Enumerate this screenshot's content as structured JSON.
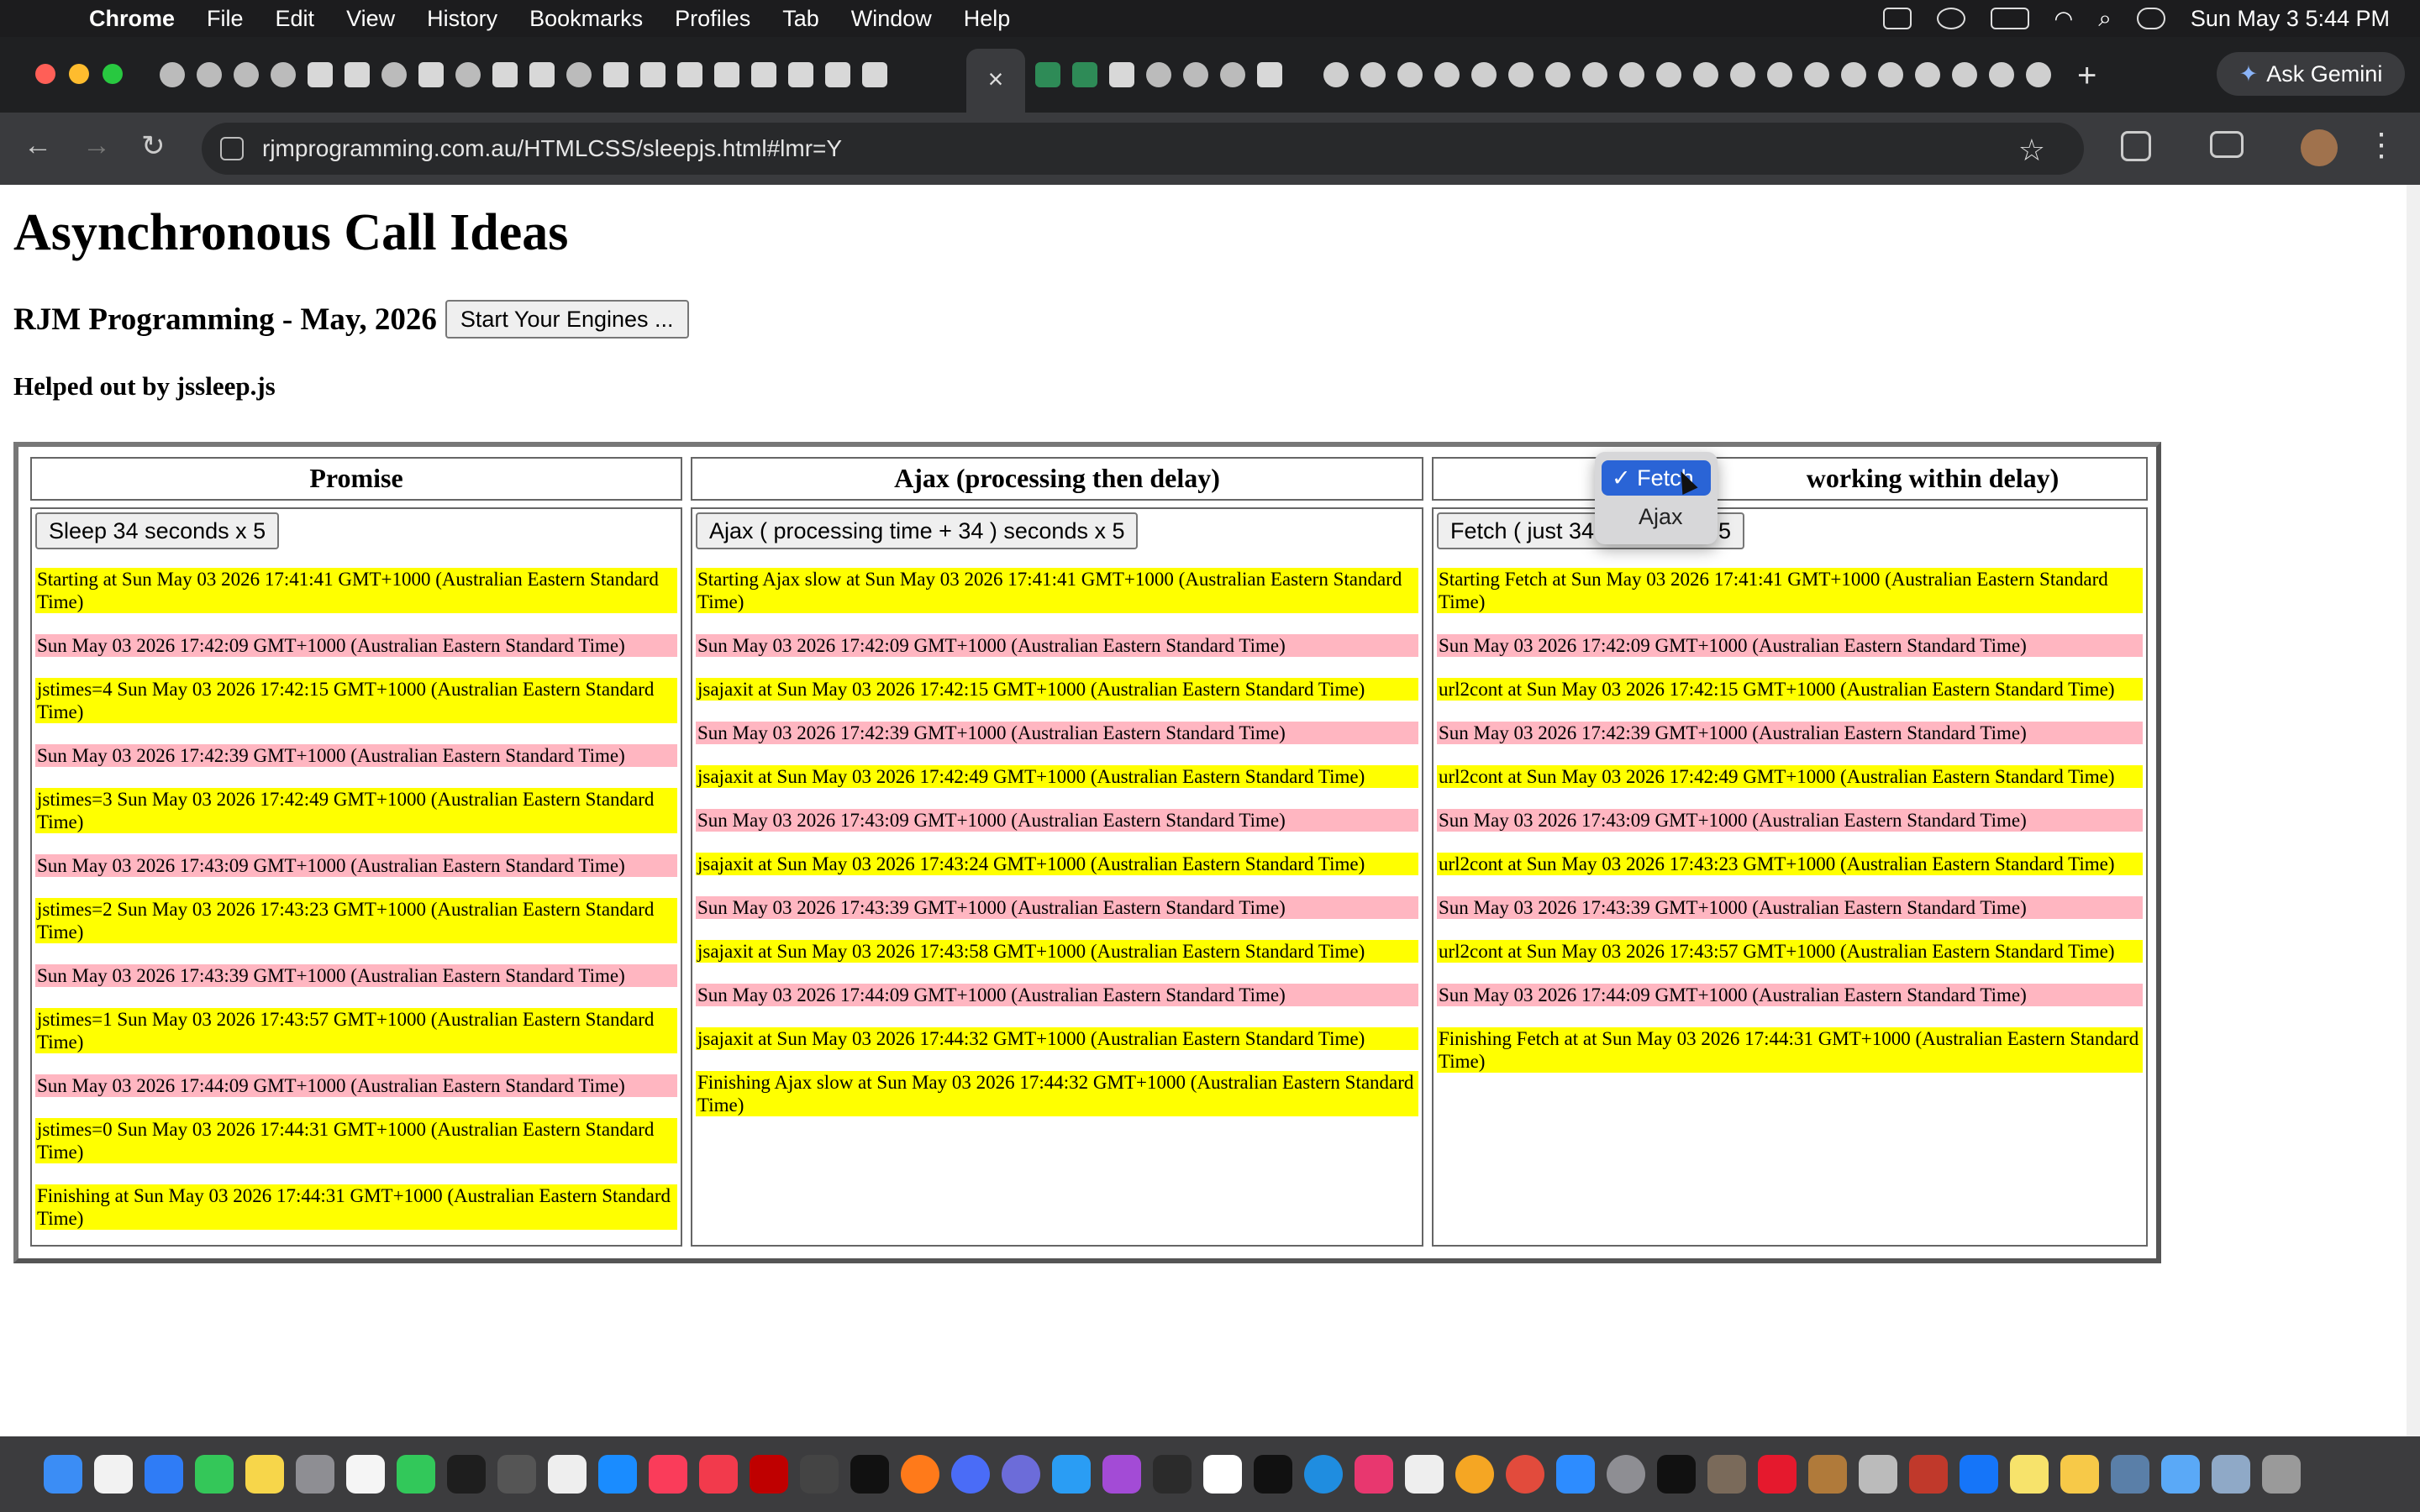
{
  "menubar": {
    "app": "Chrome",
    "items": [
      "File",
      "Edit",
      "View",
      "History",
      "Bookmarks",
      "Profiles",
      "Tab",
      "Window",
      "Help"
    ],
    "clock": "Sun May 3  5:44 PM"
  },
  "browser": {
    "url": "rjmprogramming.com.au/HTMLCSS/sleepjs.html#lmr=Y",
    "gemini_label": "Ask Gemini",
    "colors": {
      "menubar": "#1c1c1e",
      "tabbar": "#1f2022",
      "toolbar": "#3a3b3e"
    }
  },
  "page": {
    "title": "Asynchronous Call Ideas",
    "subtitle": "RJM Programming - May, 2026",
    "start_button": "Start Your Engines ...",
    "helped": "Helped out by jssleep.js",
    "colors": {
      "yellow": "#ffff00",
      "pink": "#ffb6c1"
    },
    "columns": [
      {
        "header": "Promise",
        "button": "Sleep 34 seconds x 5",
        "entries": [
          {
            "text": "Starting at Sun May 03 2026 17:41:41 GMT+1000 (Australian Eastern Standard Time)",
            "color": "yellow"
          },
          {
            "text": "Sun May 03 2026 17:42:09 GMT+1000 (Australian Eastern Standard Time)",
            "color": "pink"
          },
          {
            "text": "jstimes=4 Sun May 03 2026 17:42:15 GMT+1000 (Australian Eastern Standard Time)",
            "color": "yellow"
          },
          {
            "text": "Sun May 03 2026 17:42:39 GMT+1000 (Australian Eastern Standard Time)",
            "color": "pink"
          },
          {
            "text": "jstimes=3 Sun May 03 2026 17:42:49 GMT+1000 (Australian Eastern Standard Time)",
            "color": "yellow"
          },
          {
            "text": "Sun May 03 2026 17:43:09 GMT+1000 (Australian Eastern Standard Time)",
            "color": "pink"
          },
          {
            "text": "jstimes=2 Sun May 03 2026 17:43:23 GMT+1000 (Australian Eastern Standard Time)",
            "color": "yellow"
          },
          {
            "text": "Sun May 03 2026 17:43:39 GMT+1000 (Australian Eastern Standard Time)",
            "color": "pink"
          },
          {
            "text": "jstimes=1 Sun May 03 2026 17:43:57 GMT+1000 (Australian Eastern Standard Time)",
            "color": "yellow"
          },
          {
            "text": "Sun May 03 2026 17:44:09 GMT+1000 (Australian Eastern Standard Time)",
            "color": "pink"
          },
          {
            "text": "jstimes=0 Sun May 03 2026 17:44:31 GMT+1000 (Australian Eastern Standard Time)",
            "color": "yellow"
          },
          {
            "text": "Finishing at Sun May 03 2026 17:44:31 GMT+1000 (Australian Eastern Standard Time)",
            "color": "yellow"
          }
        ]
      },
      {
        "header": "Ajax (processing then delay)",
        "button": "Ajax ( processing time + 34 ) seconds x 5",
        "entries": [
          {
            "text": "Starting Ajax slow at Sun May 03 2026 17:41:41 GMT+1000 (Australian Eastern Standard Time)",
            "color": "yellow"
          },
          {
            "text": "Sun May 03 2026 17:42:09 GMT+1000 (Australian Eastern Standard Time)",
            "color": "pink"
          },
          {
            "text": "jsajaxit at Sun May 03 2026 17:42:15 GMT+1000 (Australian Eastern Standard Time)",
            "color": "yellow"
          },
          {
            "text": "Sun May 03 2026 17:42:39 GMT+1000 (Australian Eastern Standard Time)",
            "color": "pink"
          },
          {
            "text": "jsajaxit at Sun May 03 2026 17:42:49 GMT+1000 (Australian Eastern Standard Time)",
            "color": "yellow"
          },
          {
            "text": "Sun May 03 2026 17:43:09 GMT+1000 (Australian Eastern Standard Time)",
            "color": "pink"
          },
          {
            "text": "jsajaxit at Sun May 03 2026 17:43:24 GMT+1000 (Australian Eastern Standard Time)",
            "color": "yellow"
          },
          {
            "text": "Sun May 03 2026 17:43:39 GMT+1000 (Australian Eastern Standard Time)",
            "color": "pink"
          },
          {
            "text": "jsajaxit at Sun May 03 2026 17:43:58 GMT+1000 (Australian Eastern Standard Time)",
            "color": "yellow"
          },
          {
            "text": "Sun May 03 2026 17:44:09 GMT+1000 (Australian Eastern Standard Time)",
            "color": "pink"
          },
          {
            "text": "jsajaxit at Sun May 03 2026 17:44:32 GMT+1000 (Australian Eastern Standard Time)",
            "color": "yellow"
          },
          {
            "text": "Finishing Ajax slow at Sun May 03 2026 17:44:32 GMT+1000 (Australian Eastern Standard Time)",
            "color": "yellow"
          }
        ]
      },
      {
        "header": "working within delay)",
        "button": "Fetch ( just 34",
        "button_tail": "5",
        "entries": [
          {
            "text": "Starting Fetch at Sun May 03 2026 17:41:41 GMT+1000 (Australian Eastern Standard Time)",
            "color": "yellow"
          },
          {
            "text": "Sun May 03 2026 17:42:09 GMT+1000 (Australian Eastern Standard Time)",
            "color": "pink"
          },
          {
            "text": "url2cont at Sun May 03 2026 17:42:15 GMT+1000 (Australian Eastern Standard Time)",
            "color": "yellow"
          },
          {
            "text": "Sun May 03 2026 17:42:39 GMT+1000 (Australian Eastern Standard Time)",
            "color": "pink"
          },
          {
            "text": "url2cont at Sun May 03 2026 17:42:49 GMT+1000 (Australian Eastern Standard Time)",
            "color": "yellow"
          },
          {
            "text": "Sun May 03 2026 17:43:09 GMT+1000 (Australian Eastern Standard Time)",
            "color": "pink"
          },
          {
            "text": "url2cont at Sun May 03 2026 17:43:23 GMT+1000 (Australian Eastern Standard Time)",
            "color": "yellow"
          },
          {
            "text": "Sun May 03 2026 17:43:39 GMT+1000 (Australian Eastern Standard Time)",
            "color": "pink"
          },
          {
            "text": "url2cont at Sun May 03 2026 17:43:57 GMT+1000 (Australian Eastern Standard Time)",
            "color": "yellow"
          },
          {
            "text": "Sun May 03 2026 17:44:09 GMT+1000 (Australian Eastern Standard Time)",
            "color": "pink"
          },
          {
            "text": "Finishing Fetch at at Sun May 03 2026 17:44:31 GMT+1000 (Australian Eastern Standard Time)",
            "color": "yellow"
          }
        ]
      }
    ],
    "dropdown": {
      "selected": "Fetch",
      "check": "✓",
      "options": [
        "Fetch",
        "Ajax"
      ]
    }
  }
}
